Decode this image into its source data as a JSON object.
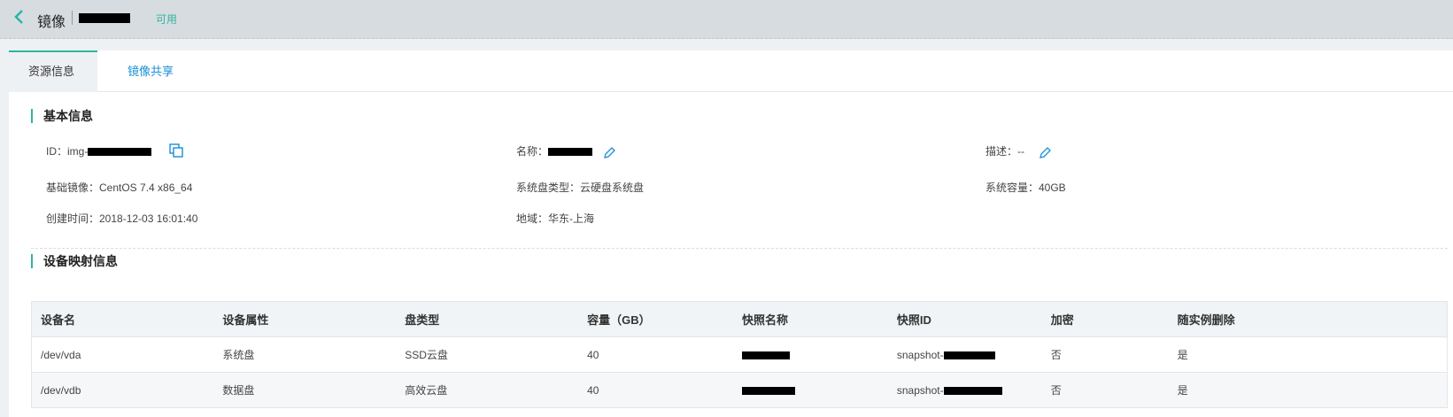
{
  "header": {
    "back_icon": "chevron-left-icon",
    "title": "镜像",
    "status": "可用",
    "accent_color": "#2eb5a0"
  },
  "tabs": [
    {
      "label": "资源信息",
      "active": true
    },
    {
      "label": "镜像共享",
      "active": false
    }
  ],
  "basic_info": {
    "section_title": "基本信息",
    "id_label": "ID：img-",
    "name_label": "名称：",
    "desc_label": "描述：--",
    "base_image": "基础镜像：CentOS 7.4 x86_64",
    "disk_type": "系统盘类型：云硬盘系统盘",
    "capacity": "系统容量：40GB",
    "created": "创建时间：2018-12-03 16:01:40",
    "region": "地域：华东-上海"
  },
  "mapping": {
    "section_title": "设备映射信息",
    "columns": [
      "设备名",
      "设备属性",
      "盘类型",
      "容量（GB）",
      "快照名称",
      "快照ID",
      "加密",
      "随实例删除"
    ],
    "rows": [
      {
        "device": "/dev/vda",
        "attr": "系统盘",
        "type": "SSD云盘",
        "capacity": "40",
        "snapshot_name": "",
        "snapshot_id": "snapshot-",
        "encrypted": "否",
        "delete_with_instance": "是"
      },
      {
        "device": "/dev/vdb",
        "attr": "数据盘",
        "type": "高效云盘",
        "capacity": "40",
        "snapshot_name": "",
        "snapshot_id": "snapshot-",
        "encrypted": "否",
        "delete_with_instance": "是"
      }
    ]
  }
}
